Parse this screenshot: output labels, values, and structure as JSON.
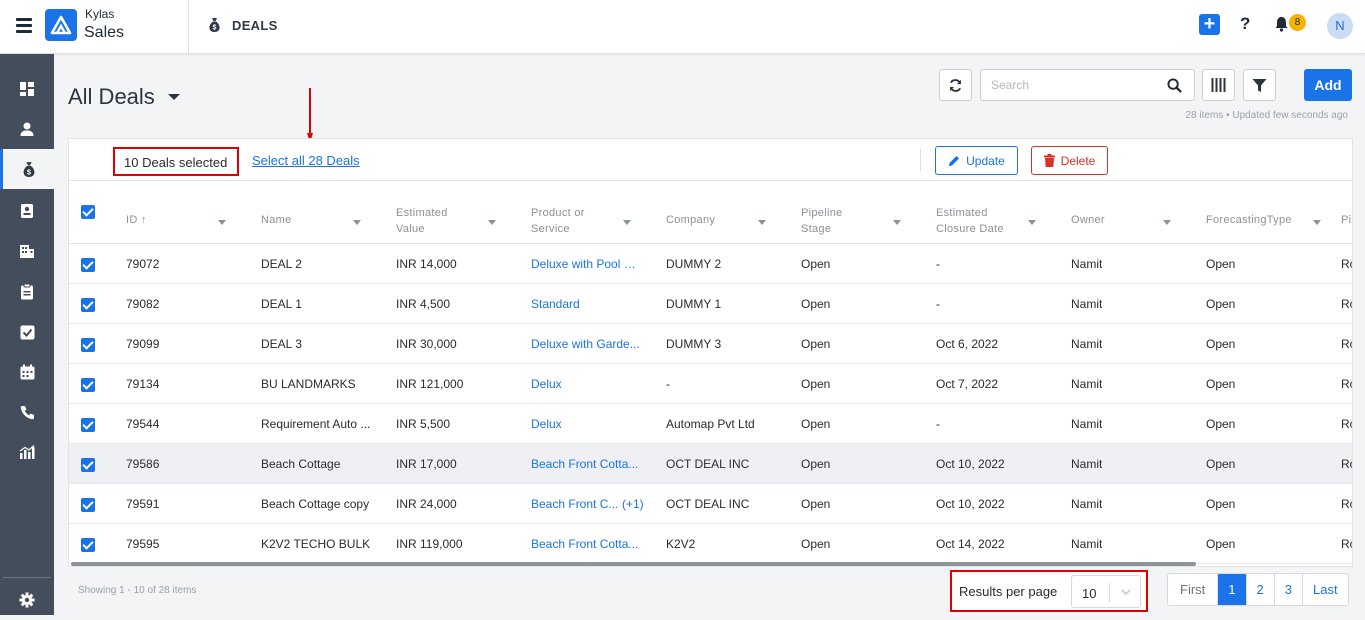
{
  "app": {
    "brand_line1": "Kylas",
    "brand_line2": "Sales",
    "module_title": "DEALS",
    "notifications_count": "8",
    "avatar_initial": "N"
  },
  "colors": {
    "accent": "#1a73e8",
    "sidebar": "#444d5b",
    "danger": "#d93025",
    "badge": "#f4b400",
    "highlight_border": "#e00000"
  },
  "sidebar": {
    "items": [
      {
        "icon": "dashboard-icon"
      },
      {
        "icon": "user-icon"
      },
      {
        "icon": "money-bag-icon",
        "active": true
      },
      {
        "icon": "contact-card-icon"
      },
      {
        "icon": "building-icon"
      },
      {
        "icon": "clipboard-icon"
      },
      {
        "icon": "task-check-icon"
      },
      {
        "icon": "calendar-icon"
      },
      {
        "icon": "phone-icon"
      },
      {
        "icon": "reports-icon"
      }
    ],
    "settings_icon": "gear-icon"
  },
  "page": {
    "title": "All Deals",
    "search_placeholder": "Search",
    "add_label": "Add",
    "meta": "28 items • Updated few seconds ago"
  },
  "bulk": {
    "selected_text": "10 Deals selected",
    "select_all_text": "Select all 28 Deals",
    "update_label": "Update",
    "delete_label": "Delete"
  },
  "table": {
    "columns": [
      "ID",
      "Name",
      "Estimated Value",
      "Product or Service",
      "Company",
      "Pipeline Stage",
      "Estimated Closure Date",
      "Owner",
      "ForecastingType",
      "Pi"
    ],
    "rows": [
      {
        "id": "79072",
        "name": "DEAL 2",
        "value": "INR 14,000",
        "product": "Deluxe with Pool vi...",
        "company": "DUMMY 2",
        "stage": "Open",
        "closure": "-",
        "owner": "Namit",
        "forecast": "Open",
        "pipe": "Ro"
      },
      {
        "id": "79082",
        "name": "DEAL 1",
        "value": "INR 4,500",
        "product": "Standard",
        "company": "DUMMY 1",
        "stage": "Open",
        "closure": "-",
        "owner": "Namit",
        "forecast": "Open",
        "pipe": "Ro"
      },
      {
        "id": "79099",
        "name": "DEAL 3",
        "value": "INR 30,000",
        "product": "Deluxe with Garde...",
        "company": "DUMMY 3",
        "stage": "Open",
        "closure": "Oct 6, 2022",
        "owner": "Namit",
        "forecast": "Open",
        "pipe": "Ro"
      },
      {
        "id": "79134",
        "name": "BU LANDMARKS",
        "value": "INR 121,000",
        "product": "Delux",
        "company": "-",
        "stage": "Open",
        "closure": "Oct 7, 2022",
        "owner": "Namit",
        "forecast": "Open",
        "pipe": "Ro"
      },
      {
        "id": "79544",
        "name": "Requirement Auto ...",
        "value": "INR 5,500",
        "product": "Delux",
        "company": "Automap Pvt Ltd",
        "stage": "Open",
        "closure": "-",
        "owner": "Namit",
        "forecast": "Open",
        "pipe": "Ro"
      },
      {
        "id": "79586",
        "name": "Beach Cottage",
        "value": "INR 17,000",
        "product": "Beach Front Cotta...",
        "company": "OCT DEAL INC",
        "stage": "Open",
        "closure": "Oct 10, 2022",
        "owner": "Namit",
        "forecast": "Open",
        "pipe": "Ro"
      },
      {
        "id": "79591",
        "name": "Beach Cottage copy",
        "value": "INR 24,000",
        "product": "Beach Front C...",
        "product_more": "(+1)",
        "company": "OCT DEAL INC",
        "stage": "Open",
        "closure": "Oct 10, 2022",
        "owner": "Namit",
        "forecast": "Open",
        "pipe": "Ro"
      },
      {
        "id": "79595",
        "name": "K2V2 TECHO BULK",
        "value": "INR 119,000",
        "product": "Beach Front Cotta...",
        "company": "K2V2",
        "stage": "Open",
        "closure": "Oct 14, 2022",
        "owner": "Namit",
        "forecast": "Open",
        "pipe": "Ro"
      }
    ]
  },
  "footer": {
    "showing": "Showing 1 - 10 of 28 items",
    "rpp_label": "Results per page",
    "rpp_value": "10",
    "pages": [
      "First",
      "1",
      "2",
      "3",
      "Last"
    ]
  }
}
